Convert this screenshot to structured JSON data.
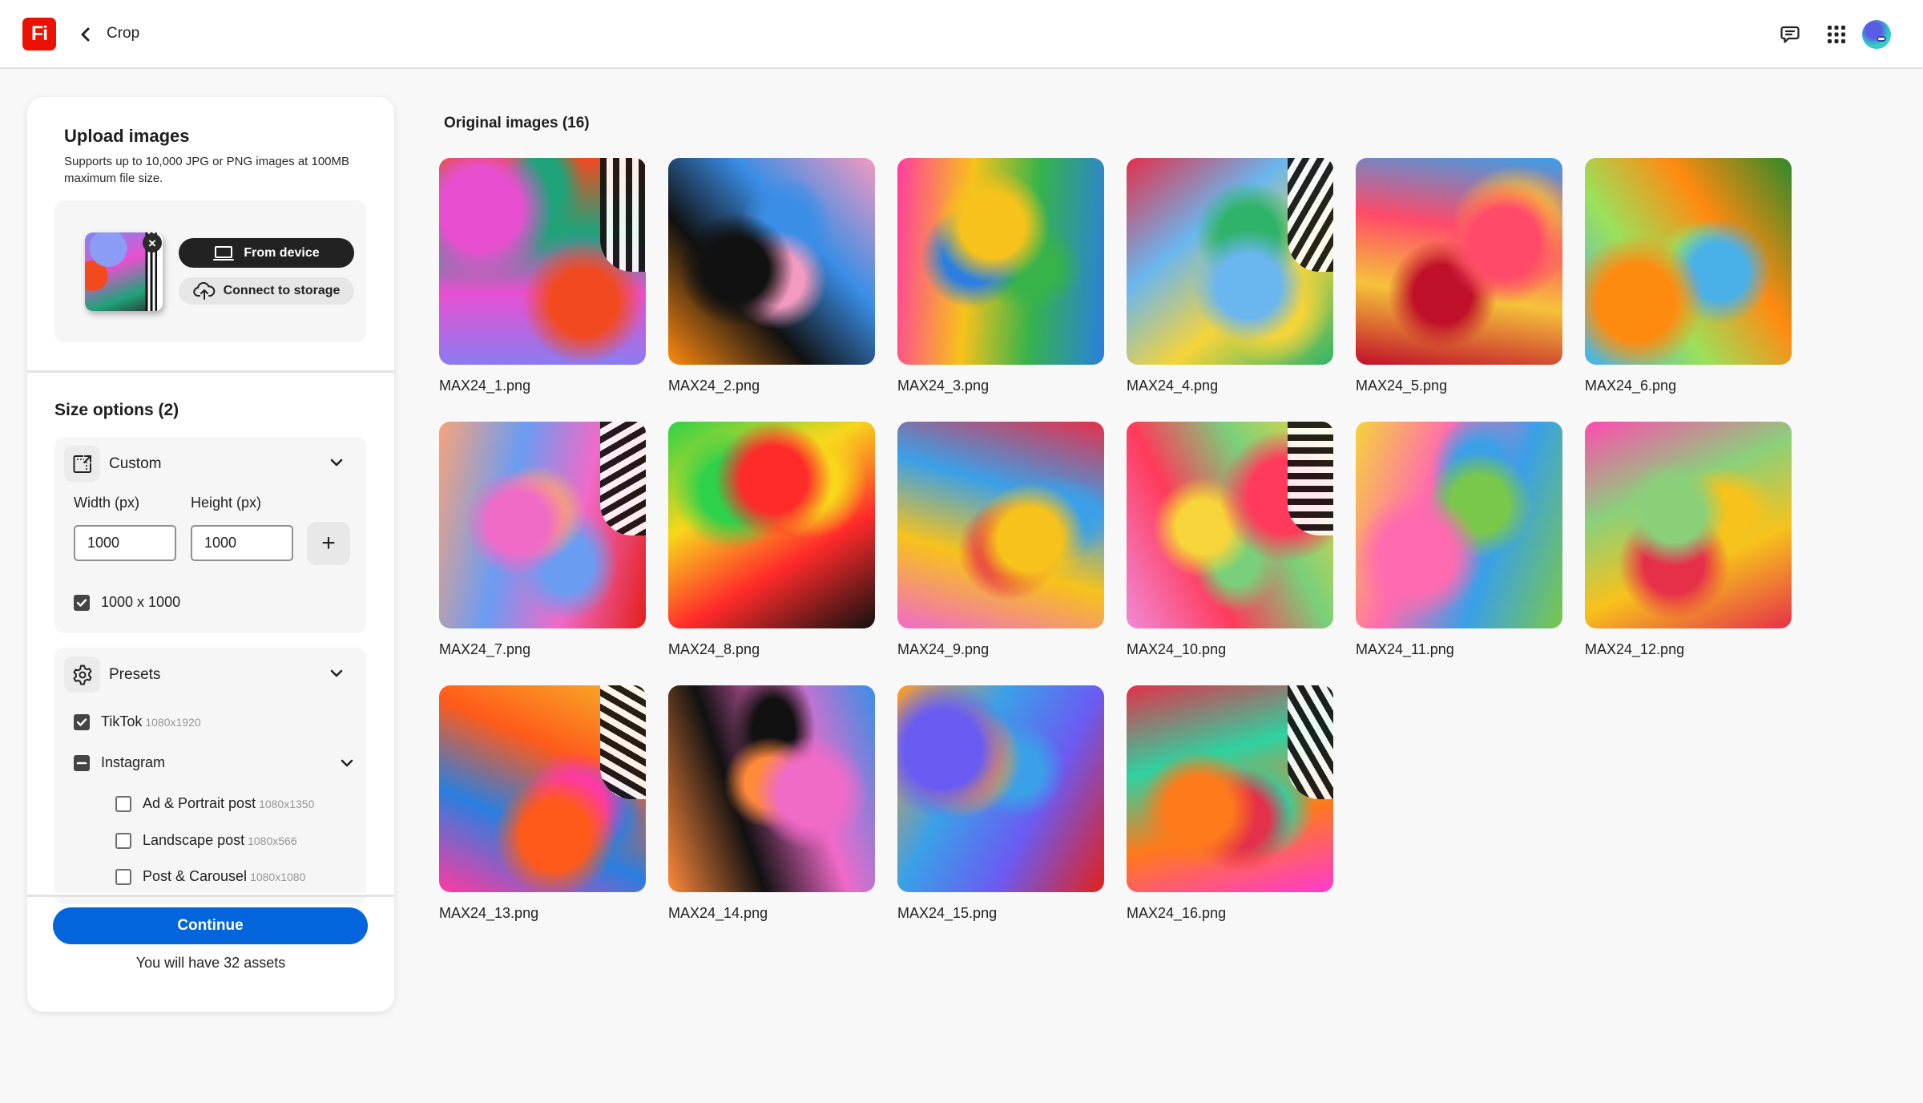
{
  "header": {
    "app_logo": "Fi",
    "back_label": "Back",
    "breadcrumb": "Crop",
    "icons": [
      "chat-icon",
      "apps-grid-icon",
      "user-avatar"
    ]
  },
  "upload": {
    "title": "Upload images",
    "subtitle": "Supports up to 10,000 JPG or PNG images at 100MB maximum file size.",
    "from_device_label": "From device",
    "connect_storage_label": "Connect to storage",
    "remove_label": "×"
  },
  "size_options": {
    "title": "Size options (2)",
    "custom": {
      "label": "Custom",
      "width_label": "Width (px)",
      "height_label": "Height (px)",
      "width_value": "1000",
      "height_value": "1000",
      "add_label": "+",
      "sizes": [
        {
          "label": "1000 x 1000",
          "checked": true
        }
      ]
    },
    "presets": {
      "label": "Presets",
      "items": [
        {
          "label": "TikTok",
          "dims": "1080x1920",
          "state": "checked"
        },
        {
          "label": "Instagram",
          "dims": "",
          "state": "mixed",
          "children": [
            {
              "label": "Ad & Portrait post",
              "dims": "1080x1350",
              "state": "unchecked"
            },
            {
              "label": "Landscape post",
              "dims": "1080x566",
              "state": "unchecked"
            },
            {
              "label": "Post & Carousel",
              "dims": "1080x1080",
              "state": "unchecked"
            }
          ]
        }
      ]
    }
  },
  "footer": {
    "continue_label": "Continue",
    "assets_text": "You will have 32 assets"
  },
  "gallery": {
    "title": "Original images (16)",
    "images": [
      {
        "name": "MAX24_1.png",
        "colors": [
          "#8a7cf0",
          "#e84fd0",
          "#1fa37a",
          "#f24a1e"
        ]
      },
      {
        "name": "MAX24_2.png",
        "colors": [
          "#ff8a10",
          "#111111",
          "#3a8ee6",
          "#f29ac0"
        ]
      },
      {
        "name": "MAX24_3.png",
        "colors": [
          "#ff3da0",
          "#f7c21b",
          "#37b34a",
          "#2a7fe0"
        ]
      },
      {
        "name": "MAX24_4.png",
        "colors": [
          "#e3304a",
          "#6ab6ee",
          "#f5d43a",
          "#2fb36a"
        ]
      },
      {
        "name": "MAX24_5.png",
        "colors": [
          "#3aa0e8",
          "#ff4a6a",
          "#f5c23a",
          "#c0102a"
        ]
      },
      {
        "name": "MAX24_6.png",
        "colors": [
          "#2e8a2a",
          "#ff8a10",
          "#9be05a",
          "#4ab0e8"
        ]
      },
      {
        "name": "MAX24_7.png",
        "colors": [
          "#e4201a",
          "#f06ac8",
          "#6a9cf2",
          "#f7a37a"
        ]
      },
      {
        "name": "MAX24_8.png",
        "colors": [
          "#111111",
          "#ff2a2a",
          "#f7d61b",
          "#2ed14a"
        ]
      },
      {
        "name": "MAX24_9.png",
        "colors": [
          "#f06ac8",
          "#f7c21b",
          "#3aa0e8",
          "#e6304a"
        ]
      },
      {
        "name": "MAX24_10.png",
        "colors": [
          "#f08ad8",
          "#ff3a5a",
          "#7ad07a",
          "#f7d43a"
        ]
      },
      {
        "name": "MAX24_11.png",
        "colors": [
          "#f5d43a",
          "#ff6ab0",
          "#3aa0e8",
          "#7ac84a"
        ]
      },
      {
        "name": "MAX24_12.png",
        "colors": [
          "#ff4ab0",
          "#8ad07a",
          "#f7c21b",
          "#e6304a"
        ]
      },
      {
        "name": "MAX24_13.png",
        "colors": [
          "#f7b42a",
          "#ff5a1a",
          "#2a7fe0",
          "#ff3aa0"
        ]
      },
      {
        "name": "MAX24_14.png",
        "colors": [
          "#3a8ee6",
          "#f06ac8",
          "#111111",
          "#ff8a3a"
        ]
      },
      {
        "name": "MAX24_15.png",
        "colors": [
          "#e4201a",
          "#6a5cf2",
          "#3aa0e8",
          "#ff9a2a"
        ]
      },
      {
        "name": "MAX24_16.png",
        "colors": [
          "#ff3ad0",
          "#ff7a1a",
          "#2fd1a0",
          "#e4304a"
        ]
      }
    ]
  },
  "colors": {
    "accent": "#0265dc",
    "brand": "#eb1000"
  }
}
